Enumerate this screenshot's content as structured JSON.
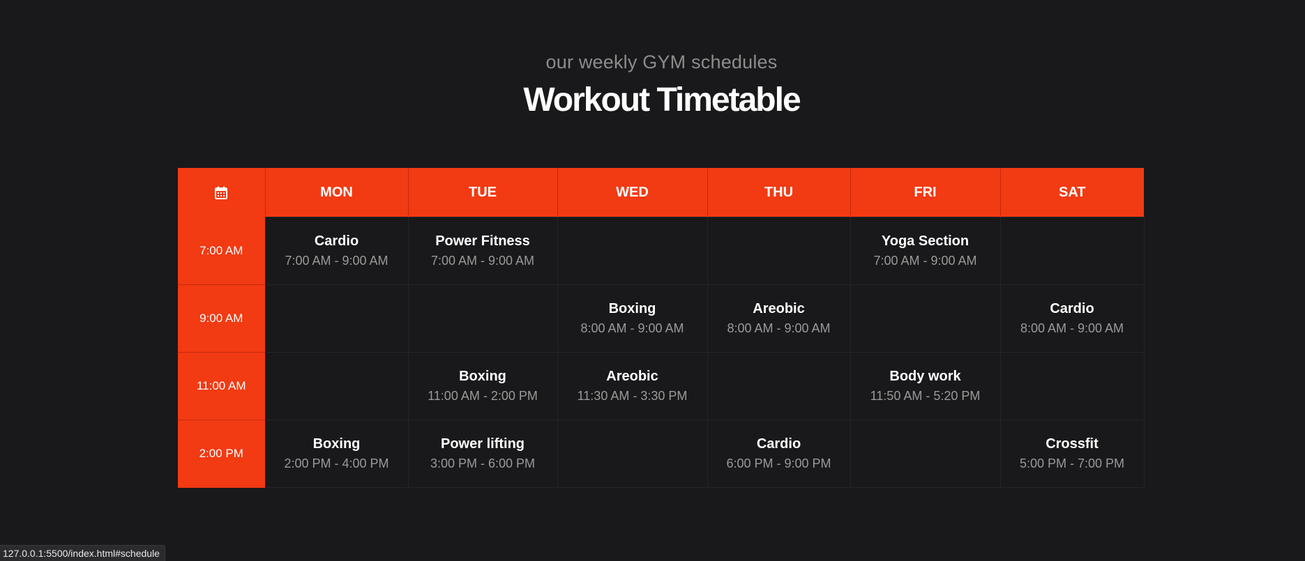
{
  "header": {
    "subtitle": "our weekly GYM schedules",
    "title": "Workout Timetable"
  },
  "timetable": {
    "corner_icon": "calendar-icon",
    "days": [
      {
        "label": "MON"
      },
      {
        "label": "TUE"
      },
      {
        "label": "WED"
      },
      {
        "label": "THU"
      },
      {
        "label": "FRI"
      },
      {
        "label": "SAT"
      }
    ],
    "rows": [
      {
        "time": "7:00 AM",
        "cells": [
          {
            "name": "Cardio",
            "hours": "7:00 AM - 9:00 AM"
          },
          {
            "name": "Power Fitness",
            "hours": "7:00 AM - 9:00 AM"
          },
          {
            "name": "",
            "hours": ""
          },
          {
            "name": "",
            "hours": ""
          },
          {
            "name": "Yoga Section",
            "hours": "7:00 AM - 9:00 AM"
          },
          {
            "name": "",
            "hours": ""
          }
        ]
      },
      {
        "time": "9:00 AM",
        "cells": [
          {
            "name": "",
            "hours": ""
          },
          {
            "name": "",
            "hours": ""
          },
          {
            "name": "Boxing",
            "hours": "8:00 AM - 9:00 AM"
          },
          {
            "name": "Areobic",
            "hours": "8:00 AM - 9:00 AM"
          },
          {
            "name": "",
            "hours": ""
          },
          {
            "name": "Cardio",
            "hours": "8:00 AM - 9:00 AM"
          }
        ]
      },
      {
        "time": "11:00 AM",
        "cells": [
          {
            "name": "",
            "hours": ""
          },
          {
            "name": "Boxing",
            "hours": "11:00 AM - 2:00 PM"
          },
          {
            "name": "Areobic",
            "hours": "11:30 AM - 3:30 PM"
          },
          {
            "name": "",
            "hours": ""
          },
          {
            "name": "Body work",
            "hours": "11:50 AM - 5:20 PM"
          },
          {
            "name": "",
            "hours": ""
          }
        ]
      },
      {
        "time": "2:00 PM",
        "cells": [
          {
            "name": "Boxing",
            "hours": "2:00 PM - 4:00 PM"
          },
          {
            "name": "Power lifting",
            "hours": "3:00 PM - 6:00 PM"
          },
          {
            "name": "",
            "hours": ""
          },
          {
            "name": "Cardio",
            "hours": "6:00 PM - 9:00 PM"
          },
          {
            "name": "",
            "hours": ""
          },
          {
            "name": "Crossfit",
            "hours": "5:00 PM - 7:00 PM"
          }
        ]
      }
    ]
  },
  "status_bar": {
    "url": "127.0.0.1:5500/index.html#schedule"
  },
  "colors": {
    "accent": "#f23a13",
    "background": "#19191b",
    "muted_text": "#9a9a9a"
  }
}
